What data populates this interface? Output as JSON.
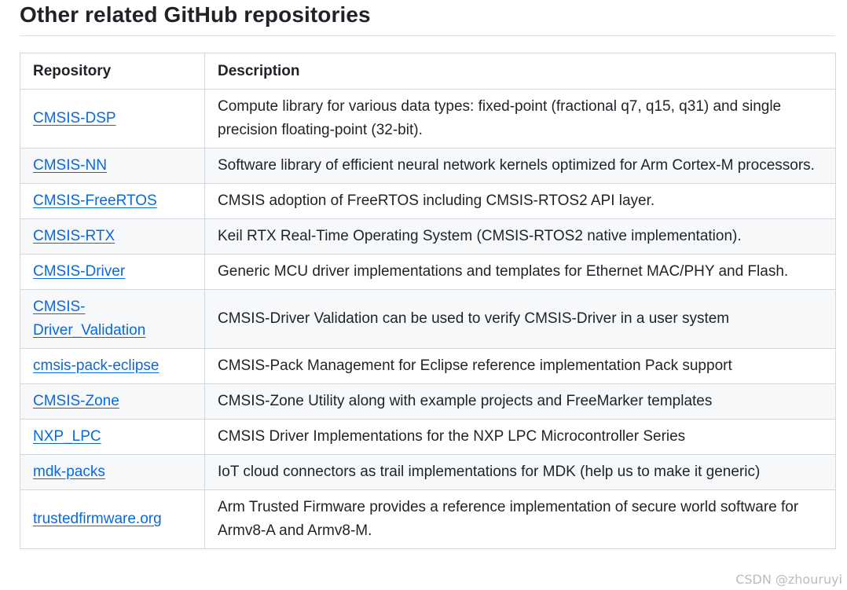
{
  "heading": "Other related GitHub repositories",
  "table": {
    "headers": [
      "Repository",
      "Description"
    ],
    "rows": [
      {
        "repo": "CMSIS-DSP",
        "description": "Compute library for various data types: fixed-point (fractional q7, q15, q31) and single precision floating-point (32-bit)."
      },
      {
        "repo": "CMSIS-NN",
        "description": "Software library of efficient neural network kernels optimized for Arm Cortex-M processors."
      },
      {
        "repo": "CMSIS-FreeRTOS",
        "description": "CMSIS adoption of FreeRTOS including CMSIS-RTOS2 API layer."
      },
      {
        "repo": "CMSIS-RTX",
        "description": "Keil RTX Real-Time Operating System (CMSIS-RTOS2 native implementation)."
      },
      {
        "repo": "CMSIS-Driver",
        "description": "Generic MCU driver implementations and templates for Ethernet MAC/PHY and Flash."
      },
      {
        "repo": "CMSIS-Driver_Validation",
        "description": "CMSIS-Driver Validation can be used to verify CMSIS-Driver in a user system"
      },
      {
        "repo": "cmsis-pack-eclipse",
        "description": "CMSIS-Pack Management for Eclipse reference implementation Pack support"
      },
      {
        "repo": "CMSIS-Zone",
        "description": "CMSIS-Zone Utility along with example projects and FreeMarker templates"
      },
      {
        "repo": "NXP_LPC",
        "description": "CMSIS Driver Implementations for the NXP LPC Microcontroller Series"
      },
      {
        "repo": "mdk-packs",
        "description": "IoT cloud connectors as trail implementations for MDK (help us to make it generic)"
      },
      {
        "repo": "trustedfirmware.org",
        "description": "Arm Trusted Firmware provides a reference implementation of secure world software for Armv8-A and Armv8-M."
      }
    ]
  },
  "watermark": "CSDN @zhouruyi",
  "colors": {
    "link": "#0969da",
    "text": "#1f2328",
    "border": "#d0d7de",
    "stripe": "#f6f8fa"
  }
}
